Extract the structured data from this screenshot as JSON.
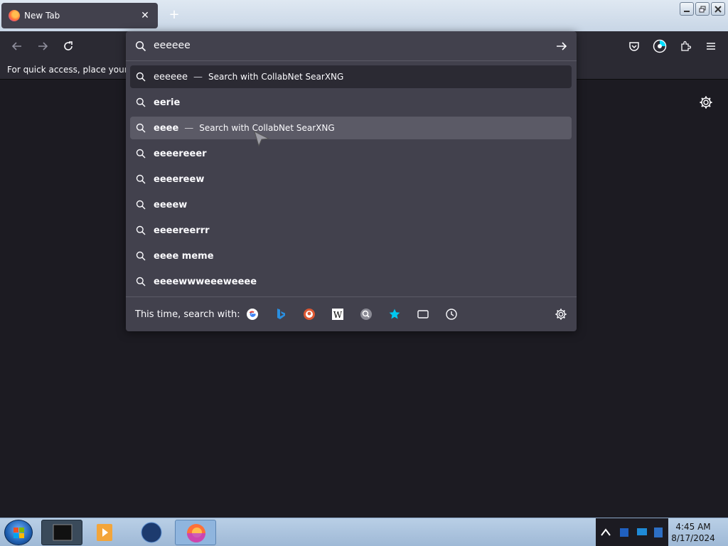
{
  "window": {
    "tab_title": "New Tab",
    "tab_close": "✕",
    "new_tab": "+"
  },
  "bookmarks_bar": {
    "text": "For quick access, place your boo"
  },
  "urlbar": {
    "value": "eeeeee"
  },
  "suggestions": [
    {
      "term": "eeeeee",
      "hint": "Search with CollabNet SearXNG",
      "state": "selected"
    },
    {
      "term": "eerie",
      "hint": "",
      "state": ""
    },
    {
      "term": "eeee",
      "hint": "Search with CollabNet SearXNG",
      "state": "hover"
    },
    {
      "term": "eeeereeer",
      "hint": "",
      "state": ""
    },
    {
      "term": "eeeereew",
      "hint": "",
      "state": ""
    },
    {
      "term": "eeeew",
      "hint": "",
      "state": ""
    },
    {
      "term": "eeeereerrr",
      "hint": "",
      "state": ""
    },
    {
      "term": "eeee meme",
      "hint": "",
      "state": ""
    },
    {
      "term": "eeeewwweeeweeee",
      "hint": "",
      "state": ""
    }
  ],
  "footer": {
    "label": "This time, search with:",
    "engines": [
      "google-icon",
      "bing-icon",
      "duckduckgo-icon",
      "wikipedia-icon",
      "searxng-icon",
      "bookmarks-icon",
      "tabs-icon",
      "history-icon"
    ]
  },
  "clock": {
    "time": "4:45 AM",
    "date": "8/17/2024"
  }
}
